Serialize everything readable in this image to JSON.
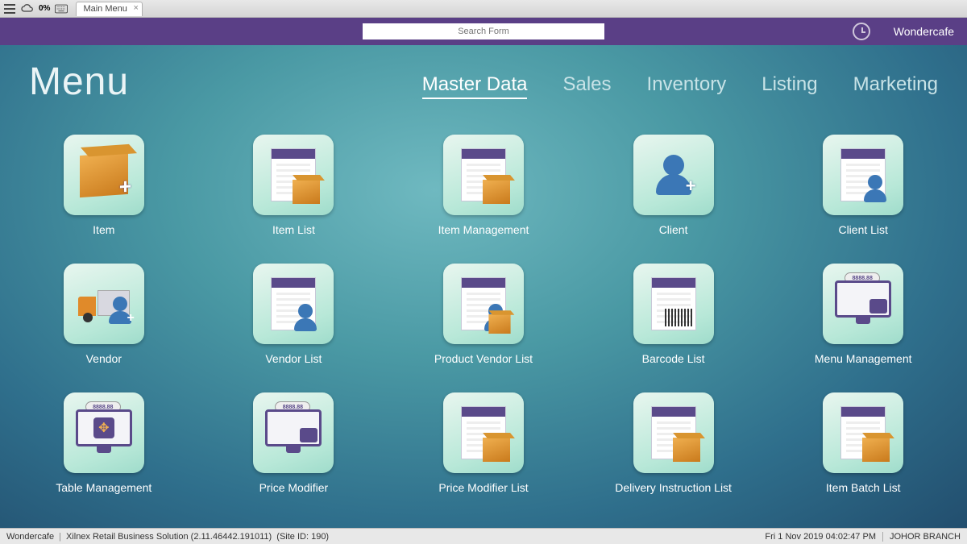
{
  "frame": {
    "percent": "0%",
    "tab_title": "Main Menu"
  },
  "header": {
    "search_placeholder": "Search Form",
    "brand": "Wondercafe"
  },
  "page_title": "Menu",
  "nav": [
    "Master Data",
    "Sales",
    "Inventory",
    "Listing",
    "Marketing"
  ],
  "nav_active": 0,
  "tiles": [
    {
      "label": "Item",
      "icon": "box-plus"
    },
    {
      "label": "Item List",
      "icon": "doc-box"
    },
    {
      "label": "Item Management",
      "icon": "doc-box"
    },
    {
      "label": "Client",
      "icon": "person-plus"
    },
    {
      "label": "Client List",
      "icon": "doc-person"
    },
    {
      "label": "Vendor",
      "icon": "truck-person-plus"
    },
    {
      "label": "Vendor List",
      "icon": "doc-person"
    },
    {
      "label": "Product Vendor List",
      "icon": "doc-person-box"
    },
    {
      "label": "Barcode List",
      "icon": "doc-barcode"
    },
    {
      "label": "Menu Management",
      "icon": "monitor-util"
    },
    {
      "label": "Table Management",
      "icon": "monitor-arrows"
    },
    {
      "label": "Price Modifier",
      "icon": "monitor-util"
    },
    {
      "label": "Price Modifier List",
      "icon": "doc-box"
    },
    {
      "label": "Delivery Instruction List",
      "icon": "doc-box"
    },
    {
      "label": "Item Batch List",
      "icon": "doc-box"
    }
  ],
  "monitor_tag": "8888.88",
  "status": {
    "company": "Wondercafe",
    "app": "Xilnex Retail Business Solution (2.11.46442.191011)",
    "site": "(Site ID: 190)",
    "datetime": "Fri 1 Nov 2019  04:02:47 PM",
    "location": "JOHOR BRANCH"
  }
}
